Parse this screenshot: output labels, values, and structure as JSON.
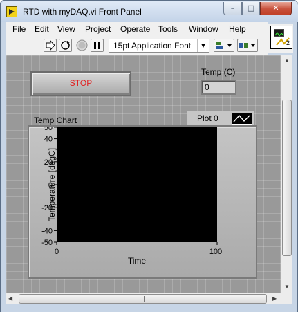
{
  "window": {
    "title": "RTD with myDAQ.vi Front Panel",
    "minimize_glyph": "–",
    "maximize_glyph": "□",
    "close_glyph": "✕"
  },
  "menu": {
    "items": [
      "File",
      "Edit",
      "View",
      "Project",
      "Operate",
      "Tools",
      "Window",
      "Help"
    ]
  },
  "toolbar": {
    "run_icon": "run-arrow-icon",
    "run_continuous_icon": "run-continuously-icon",
    "abort_icon": "abort-icon",
    "pause_icon": "pause-icon",
    "font_value": "15pt Application Font",
    "align_icon": "align-objects-icon",
    "distribute_icon": "distribute-objects-icon",
    "connector_pane_number": "2"
  },
  "panel": {
    "stop_button_label": "STOP",
    "stop_button_text_color": "#e02020",
    "temp_label": "Temp (C)",
    "temp_value": "0",
    "chart_label": "Temp Chart",
    "legend_label": "Plot 0"
  },
  "chart_data": {
    "type": "line",
    "title": "Temp Chart",
    "xlabel": "Time",
    "ylabel": "Temperature [degC]",
    "x_ticks": [
      0,
      100
    ],
    "y_ticks": [
      50,
      40,
      20,
      0,
      -20,
      -40,
      -50
    ],
    "xlim": [
      0,
      100
    ],
    "ylim": [
      -50,
      50
    ],
    "grid": false,
    "legend": "top-right",
    "plot_background": "#000000",
    "series": [
      {
        "name": "Plot 0",
        "x": [],
        "y": []
      }
    ]
  }
}
